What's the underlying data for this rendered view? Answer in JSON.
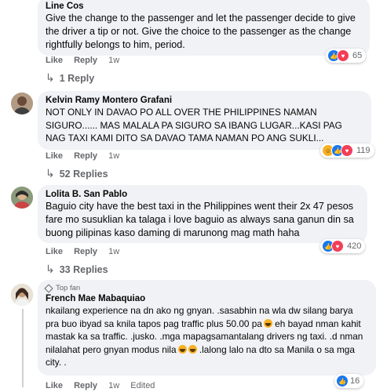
{
  "comments": [
    {
      "author": "Line Cos",
      "text": "Give the change to the passenger and let the passenger decide to give the driver a tip or not. Give the choice to the passenger as the change rightfully belongs to him, period.",
      "like_label": "Like",
      "reply_label": "Reply",
      "time": "1w",
      "reaction_count": "65",
      "replies_label": "1 Reply"
    },
    {
      "author": "Kelvin Ramy Montero Grafani",
      "text": "NOT ONLY IN DAVAO PO ALL OVER THE PHILIPPINES NAMAN SIGURO...... MAS MALALA PA SIGURO SA IBANG LUGAR...KASI PAG NAG TAXI KAMI DITO SA DAVAO TAMA NAMAN PO ANG SUKLI...",
      "like_label": "Like",
      "reply_label": "Reply",
      "time": "1w",
      "reaction_count": "119",
      "replies_label": "52 Replies"
    },
    {
      "author": "Lolita B. San Pablo",
      "text": "Baguio city have the best taxi in the Philippines went their 2x 47 pesos fare mo susuklian ka talaga i love baguio as always sana ganun din sa buong pilipinas kaso daming di marunong mag math haha",
      "like_label": "Like",
      "reply_label": "Reply",
      "time": "1w",
      "reaction_count": "420",
      "replies_label": "33 Replies"
    },
    {
      "badge": "Top fan",
      "author": "French Mae Mabaquiao",
      "text_part1": "nkailang experience na dn ako ng gnyan. .sasabhin na wla dw silang barya pra buo ibyad sa knila tapos pag traffic plus 50.00 pa",
      "text_part2": " eh bayad nman kahit mastak ka sa traffic. .jusko. .mga mapagsamantalang drivers ng taxi. .d nman nilalahat pero gnyan modus nila",
      "text_part3": " .lalong lalo na dto sa Manila o sa mga city. .",
      "like_label": "Like",
      "reply_label": "Reply",
      "time": "1w",
      "edited_label": "Edited",
      "reaction_count": "16"
    }
  ],
  "colors": {
    "bubble": "#f0f2f5",
    "meta": "#65676b",
    "like": "#1877f2",
    "love": "#f33e58",
    "haha": "#f7b125"
  }
}
